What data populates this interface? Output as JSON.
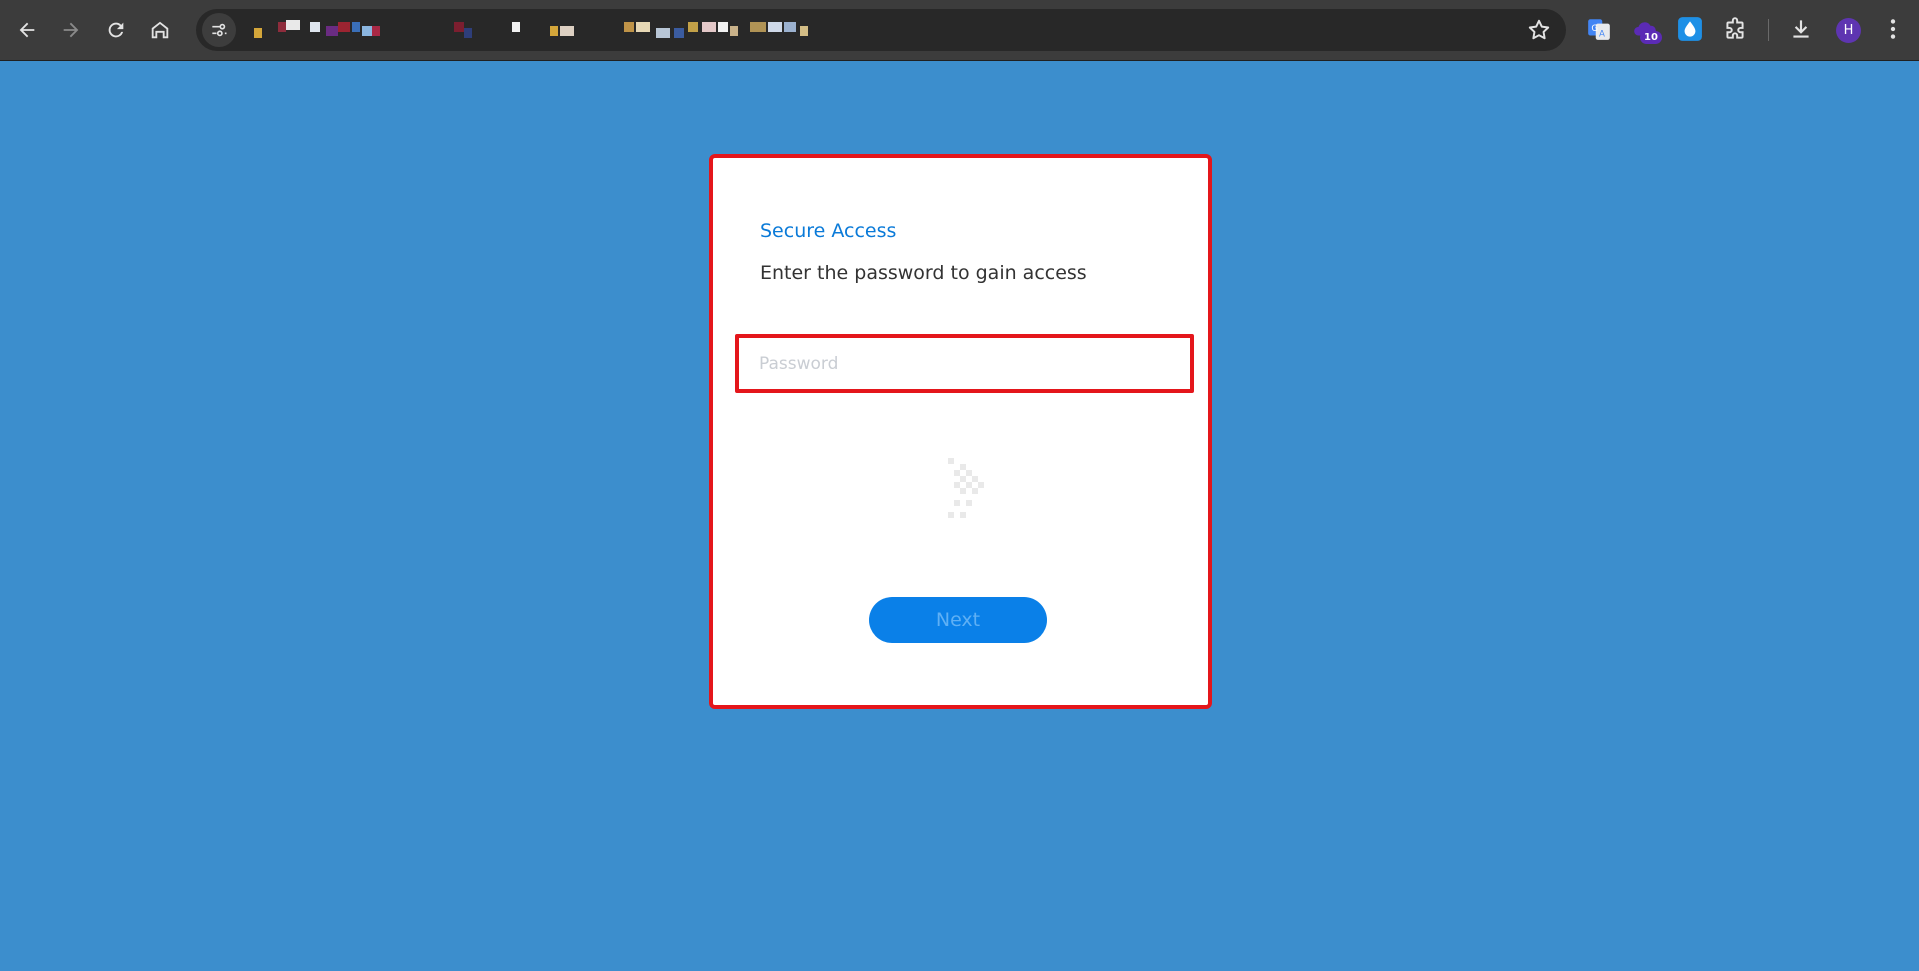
{
  "browser": {
    "extension_badge": "10",
    "profile_initial": "H",
    "colors": {
      "toolbar": "#3c3c3c",
      "omnibox": "#282828",
      "profile": "#5e35b1"
    },
    "icons": [
      "back-icon",
      "forward-icon",
      "reload-icon",
      "home-icon",
      "site-info-icon",
      "bookmark-star-icon",
      "google-translate-icon",
      "extension-puzzle-icon",
      "download-icon",
      "menu-icon"
    ]
  },
  "page": {
    "background_color": "#3c8ecd"
  },
  "dialog": {
    "title": "Secure Access",
    "subtitle": "Enter the password to gain access",
    "password_placeholder": "Password",
    "password_value": "",
    "next_label": "Next",
    "colors": {
      "title": "#0a7ad8",
      "button": "#0a80e8",
      "highlight_border": "#e4161b"
    }
  }
}
